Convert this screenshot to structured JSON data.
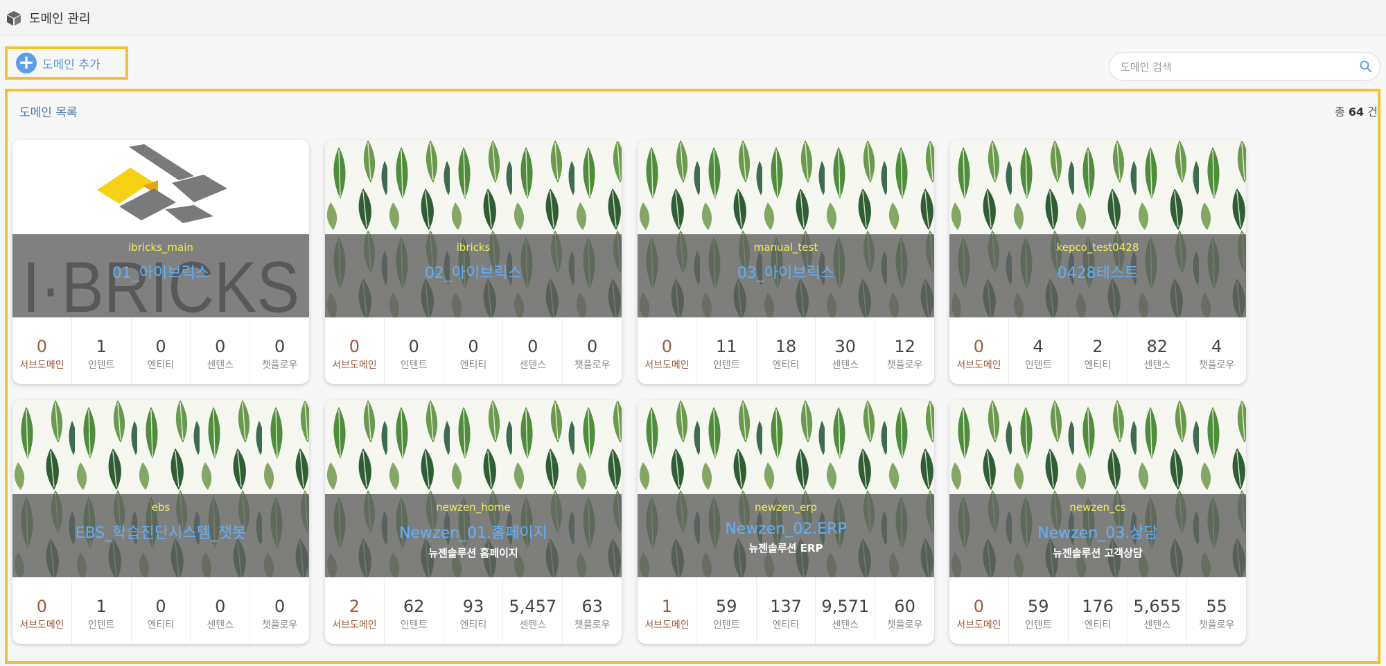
{
  "header": {
    "title": "도메인 관리",
    "icon": "cube-icon"
  },
  "toolbar": {
    "add_label": "도메인 추가",
    "search_placeholder": "도메인 검색"
  },
  "list": {
    "title": "도메인 목록",
    "total_prefix": "총",
    "total": "64",
    "total_suffix": "건"
  },
  "stat_labels": [
    "서브도메인",
    "인텐트",
    "엔티티",
    "센텐스",
    "챗플로우"
  ],
  "cards": [
    {
      "name": "ibricks_main",
      "title": "01_아이브릭스",
      "desc": "",
      "image": "ibricks-logo",
      "logo_text": "I·BRICKS",
      "stats": [
        "0",
        "1",
        "0",
        "0",
        "0"
      ]
    },
    {
      "name": "ibricks",
      "title": "02_아이브릭스",
      "desc": "",
      "image": "leaves",
      "stats": [
        "0",
        "0",
        "0",
        "0",
        "0"
      ]
    },
    {
      "name": "manual_test",
      "title": "03_아이브릭스",
      "desc": "",
      "image": "leaves",
      "stats": [
        "0",
        "11",
        "18",
        "30",
        "12"
      ]
    },
    {
      "name": "kepco_test0428",
      "title": "0428테스트",
      "desc": "",
      "image": "leaves",
      "stats": [
        "0",
        "4",
        "2",
        "82",
        "4"
      ]
    },
    {
      "name": "ebs",
      "title": "EBS_학습진단시스템_챗봇",
      "desc": "",
      "image": "leaves",
      "stats": [
        "0",
        "1",
        "0",
        "0",
        "0"
      ]
    },
    {
      "name": "newzen_home",
      "title": "Newzen_01.홈페이지",
      "desc": "뉴젠솔루션 홈페이지",
      "image": "leaves",
      "stats": [
        "2",
        "62",
        "93",
        "5,457",
        "63"
      ]
    },
    {
      "name": "newzen_erp",
      "title": "Newzen_02.ERP",
      "desc": "뉴젠솔루션 ERP",
      "image": "leaves",
      "stats": [
        "1",
        "59",
        "137",
        "9,571",
        "60"
      ]
    },
    {
      "name": "newzen_cs",
      "title": "Newzen_03.상담",
      "desc": "뉴젠솔루션 고객상담",
      "image": "leaves",
      "stats": [
        "0",
        "59",
        "176",
        "5,655",
        "55"
      ]
    }
  ],
  "colors": {
    "accent_yellow": "#f6c22a",
    "link_blue": "#5b95d6",
    "domain_name": "#f2ee57",
    "domain_title": "#5fb1ff",
    "subdomain": "#9b5b3d"
  }
}
